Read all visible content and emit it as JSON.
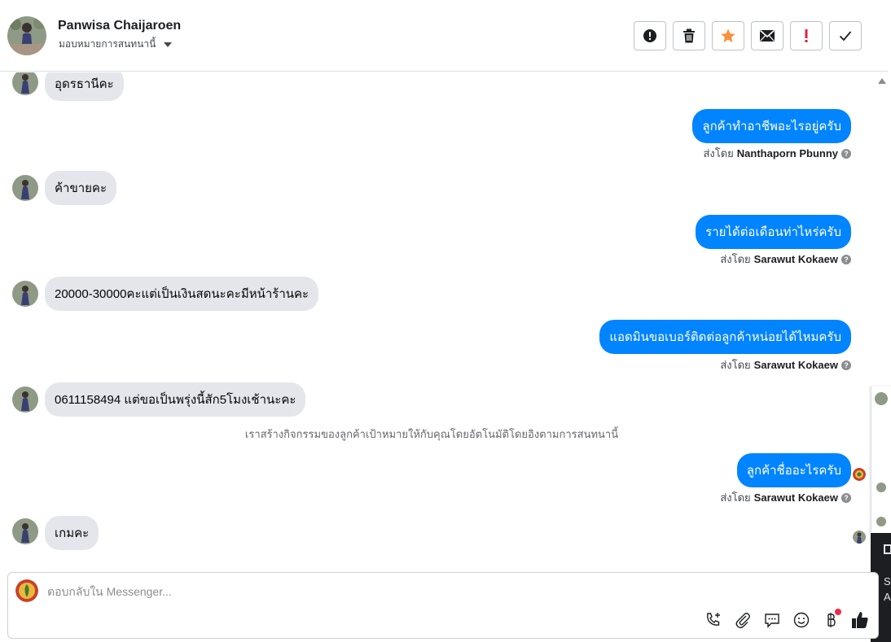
{
  "header": {
    "contact_name": "Panwisa Chaijaroen",
    "assign_label": "มอบหมายการสนทนานี้"
  },
  "actions": [
    {
      "name": "mark-spam-button",
      "icon": "alert-circle-icon"
    },
    {
      "name": "delete-button",
      "icon": "trash-icon"
    },
    {
      "name": "star-button",
      "icon": "star-icon",
      "color": "#f7923b"
    },
    {
      "name": "mark-unread-button",
      "icon": "envelope-icon"
    },
    {
      "name": "follow-up-button",
      "icon": "exclamation-icon",
      "color": "#e41e3f"
    },
    {
      "name": "mark-done-button",
      "icon": "checkmark-icon"
    }
  ],
  "messages": {
    "in1": "อุดรธานีคะ",
    "out1": "ลูกค้าทำอาชีพอะไรอยู่ครับ",
    "out1_sender": "Nanthaporn Pbunny",
    "in2": "ค้าขายคะ",
    "out2": "รายได้ต่อเดือนท่าไหร่ครับ",
    "out2_sender": "Sarawut Kokaew",
    "in3": "20000-30000คะแต่เป็นเงินสดนะคะมีหน้าร้านคะ",
    "out3": "แอดมินขอเบอร์ติดต่อลูกค้าหน่อยได้ไหมครับ",
    "out3_sender": "Sarawut Kokaew",
    "in4": "0611158494 แต่ขอเป็นพรุ่งนี้สัก5โมงเช้านะคะ",
    "system_note": "เราสร้างกิจกรรมของลูกค้าเป้าหมายให้กับคุณโดยอัตโนมัติโดยอิงตามการสนทนานี้",
    "out4": "ลูกค้าชื่ออะไรครับ",
    "out4_sender": "Sarawut Kokaew",
    "in5": "เกมคะ",
    "sent_by_prefix": "ส่งโดย"
  },
  "composer": {
    "placeholder": "ตอบกลับใน Messenger..."
  },
  "tools": [
    "phone-plus-icon",
    "paperclip-icon",
    "saved-replies-icon",
    "emoji-icon",
    "baht-payment-icon",
    "thumbs-up-icon"
  ],
  "side_panel": {
    "line1": "Se",
    "line2": "A"
  },
  "colors": {
    "outgoing_bubble": "#0084ff",
    "incoming_bubble": "#e4e6eb",
    "thumbs_up": "#1c1e21"
  }
}
